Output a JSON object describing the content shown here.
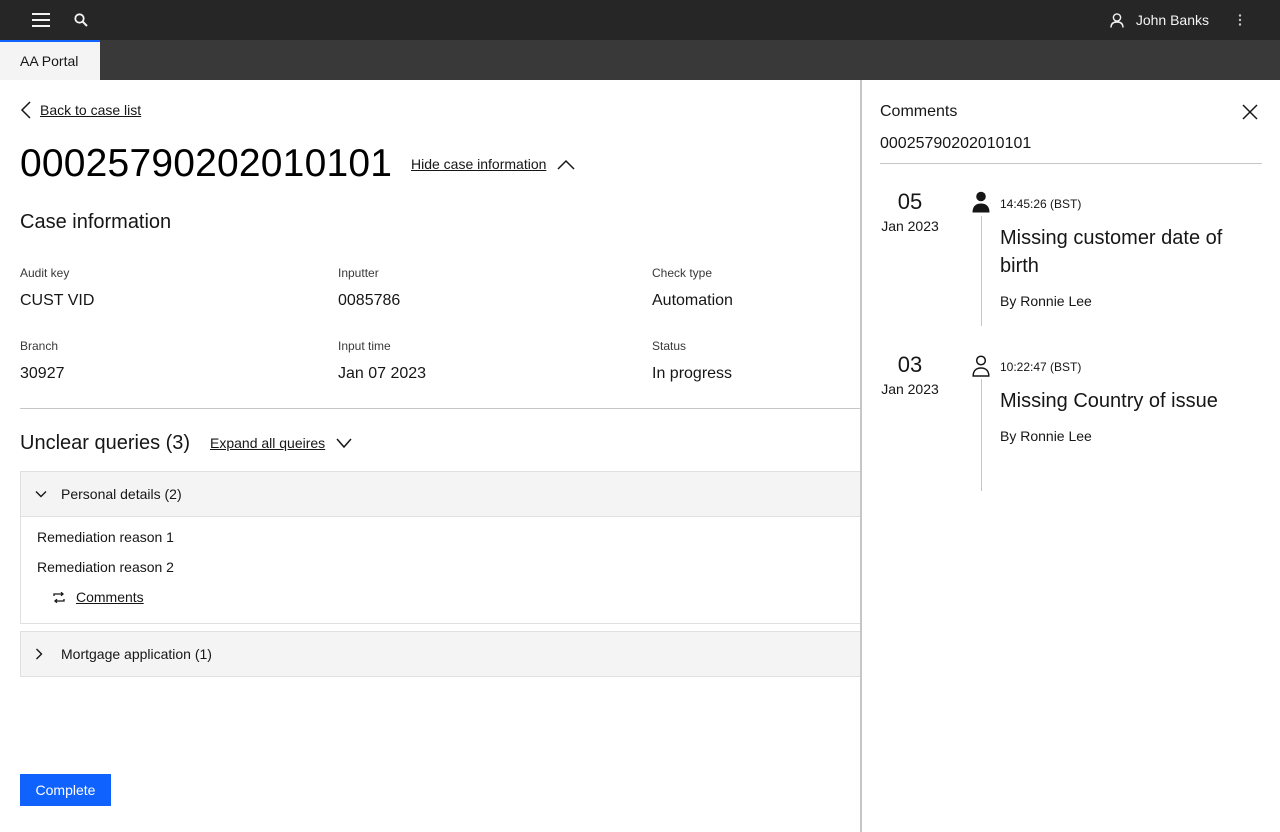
{
  "topbar": {
    "menu_icon": "hamburger-menu-icon",
    "search_icon": "search-icon",
    "user_icon": "user-icon",
    "user_name": "John Banks",
    "overflow_icon": "overflow-menu-vertical-icon"
  },
  "tabs": [
    {
      "label": "AA Portal",
      "active": true
    }
  ],
  "accent_color": "#0f62fe",
  "main": {
    "back_label": "Back to case list",
    "case_id": "00025790202010101",
    "hide_info_label": "Hide case information",
    "section_title": "Case information",
    "fields": [
      {
        "label": "Audit key",
        "value": "CUST VID"
      },
      {
        "label": "Inputter",
        "value": "0085786"
      },
      {
        "label": "Check type",
        "value": "Automation"
      },
      {
        "label": "Branch",
        "value": "30927"
      },
      {
        "label": "Input time",
        "value": "Jan 07 2023"
      },
      {
        "label": "Status",
        "value": "In progress"
      }
    ],
    "queries_title": "Unclear queries (3)",
    "expand_all_label": "Expand all queires",
    "accordions": [
      {
        "label": "Personal details (2)",
        "expanded": true,
        "reasons": [
          "Remediation reason 1",
          "Remediation reason 2"
        ],
        "comments_label": "Comments"
      },
      {
        "label": "Mortgage application (1)",
        "expanded": false
      }
    ],
    "complete_label": "Complete"
  },
  "comments_panel": {
    "title": "Comments",
    "case_id": "00025790202010101",
    "entries": [
      {
        "day": "05",
        "month": "Jan 2023",
        "time": "14:45:26 (BST)",
        "title": "Missing customer date of birth",
        "author": "By Ronnie Lee",
        "icon": "person-filled-icon"
      },
      {
        "day": "03",
        "month": "Jan 2023",
        "time": "10:22:47 (BST)",
        "title": "Missing Country of issue",
        "author": "By Ronnie Lee",
        "icon": "person-outline-icon"
      }
    ]
  }
}
